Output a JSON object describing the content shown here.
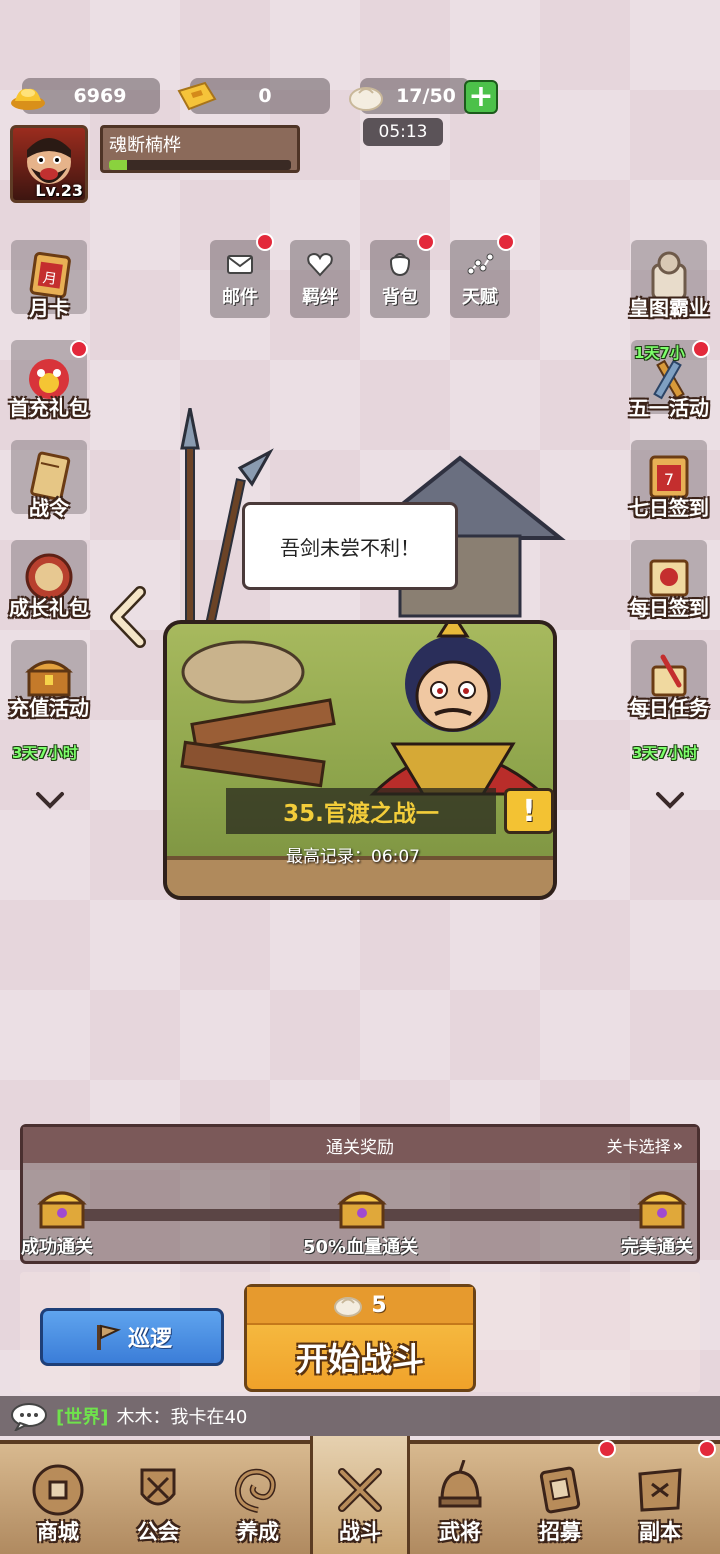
{
  "resources": {
    "gold": "6969",
    "ticket": "0",
    "stamina": "17/50",
    "stamina_timer": "05:13"
  },
  "player": {
    "name": "魂断楠桦",
    "level": "Lv.23",
    "xp_fraction": 0.1
  },
  "menu": {
    "mail": "邮件",
    "bond": "羁绊",
    "bag": "背包",
    "talent": "天赋"
  },
  "left_events": {
    "monthly_card": "月卡",
    "first_recharge": "首充礼包",
    "battle_pass": "战令",
    "growth_gift": "成长礼包",
    "recharge_event": "充值活动",
    "recharge_timer": "3天7小时"
  },
  "right_events": {
    "emperor": "皇图霸业",
    "may_day_timer": "1天7小",
    "may_day": "五一活动",
    "seven_day": "七日签到",
    "daily_signin": "每日签到",
    "daily_tasks": "每日任务",
    "daily_tasks_timer": "3天7小时"
  },
  "stage": {
    "speech": "吾剑未尝不利！",
    "name": "35.官渡之战一",
    "record": "最高记录：06:07",
    "excl": "!"
  },
  "rewards": {
    "title": "通关奖励",
    "select": "关卡选择",
    "tier1": "成功通关",
    "tier2": "50%血量通关",
    "tier3": "完美通关"
  },
  "actions": {
    "patrol": "巡逻",
    "cost": "5",
    "fight": "开始战斗"
  },
  "chat": {
    "channel": "[世界]",
    "message": "木木：我卡在40"
  },
  "nav": {
    "shop": "商城",
    "guild": "公会",
    "cultivate": "养成",
    "battle": "战斗",
    "generals": "武将",
    "recruit": "招募",
    "dungeon": "副本"
  },
  "colors": {
    "accent_gold": "#f3cd3a",
    "notify_red": "#e3293b",
    "timer_green": "#7dff6b",
    "world_green": "#6fe24c"
  }
}
